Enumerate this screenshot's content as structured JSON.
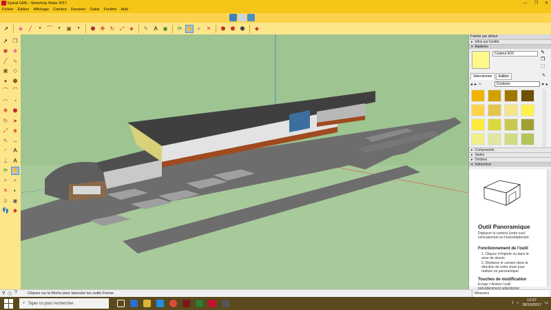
{
  "window": {
    "title": "Epinal GRE - SketchUp Make 2017",
    "controls": [
      "—",
      "❐",
      "✕"
    ]
  },
  "menu": [
    "Fichier",
    "Edition",
    "Affichage",
    "Caméra",
    "Dessiner",
    "Outils",
    "Fenêtre",
    "Aide"
  ],
  "panel": {
    "header": "Palette par défaut",
    "entity_info": "Infos sur l'entité",
    "materials": "Matières",
    "material_name": "Couleur E03",
    "tab_select": "Sélectionner",
    "tab_edit": "Edition",
    "category": "Couleurs",
    "swatches": [
      "#f0b400",
      "#d2a000",
      "#a07800",
      "#6e5000",
      "#ffd24b",
      "#e6c34b",
      "#f5e68c",
      "#fff050",
      "#ffeb3c",
      "#dcd73c",
      "#c8c850",
      "#a0a032",
      "#f0f08c",
      "#e1e6a0",
      "#d2dc82",
      "#b4c35a"
    ],
    "components": "Composants",
    "styles": "Styles",
    "shadows": "Ombres",
    "instructor": "Instructeur",
    "instructor_title": "Outil Panoramique",
    "instructor_desc": "Déplacer la caméra (votre vue) verticalement ou horizontalement.",
    "instructor_h1": "Fonctionnement de l'outil",
    "instructor_steps": [
      "1. Cliquez n'importe où dans la zone de dessin.",
      "2. Déplacez le curseur dans la direction de votre choix pour réaliser un panoramique"
    ],
    "instructor_h2": "Touches de modification",
    "instructor_mod": "Echap = Activer l'outil précédemment sélectionné"
  },
  "status": {
    "message": "Cliquez sur la flèche pour basculer les outils Forme.",
    "measures_label": "Mesures"
  },
  "taskbar": {
    "search_placeholder": "Taper ici pour rechercher",
    "time": "12:27",
    "date": "28/10/2017"
  }
}
